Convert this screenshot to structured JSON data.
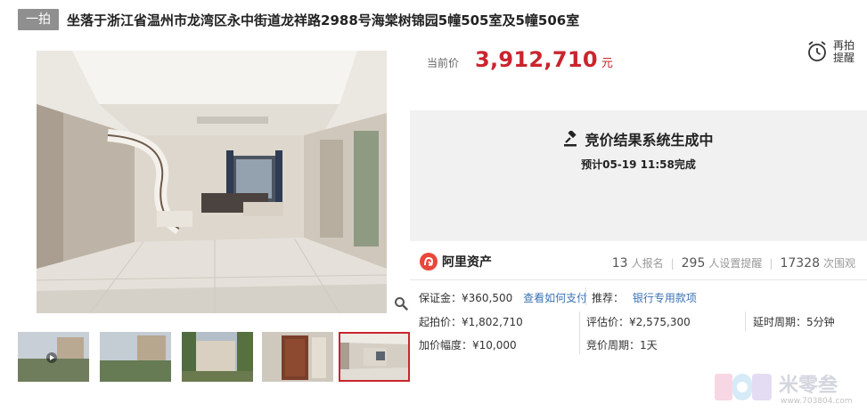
{
  "header": {
    "tag": "一拍",
    "title": "坐落于浙江省温州市龙湾区永中街道龙祥路2988号海棠树锦园5幢505室及5幢506室"
  },
  "price": {
    "label": "当前价",
    "value": "3,912,710",
    "unit": "元"
  },
  "remind": {
    "line1": "再拍",
    "line2": "提醒"
  },
  "status": {
    "title": "竞价结果系统生成中",
    "subtitle": "预计05-19 11:58完成"
  },
  "agency": {
    "name": "阿里资产"
  },
  "stats": [
    {
      "num": "13",
      "label": "人报名"
    },
    {
      "num": "295",
      "label": "人设置提醒"
    },
    {
      "num": "17328",
      "label": "次围观"
    }
  ],
  "details": {
    "deposit_label": "保证金：",
    "deposit_value": "¥360,500",
    "deposit_link": "查看如何支付",
    "recommend_label": "推荐：",
    "recommend_link": "银行专用款项",
    "start_label": "起拍价：",
    "start_value": "¥1,802,710",
    "eval_label": "评估价：",
    "eval_value": "¥2,575,300",
    "delay_label": "延时周期：",
    "delay_value": "5分钟",
    "increment_label": "加价幅度：",
    "increment_value": "¥10,000",
    "cycle_label": "竞价周期：",
    "cycle_value": "1天"
  },
  "watermark": {
    "text": "米零叁",
    "url": "www.703804.com"
  },
  "icons": {
    "zoom": "magnifier-icon",
    "remind": "alarm-clock-icon",
    "gavel": "gavel-icon",
    "agency_logo": "ali-asset-logo"
  },
  "colors": {
    "accent": "#c9252e",
    "link": "#3a71b4",
    "tag_bg": "#8f8f8f",
    "status_bg": "#f1f1f1"
  }
}
